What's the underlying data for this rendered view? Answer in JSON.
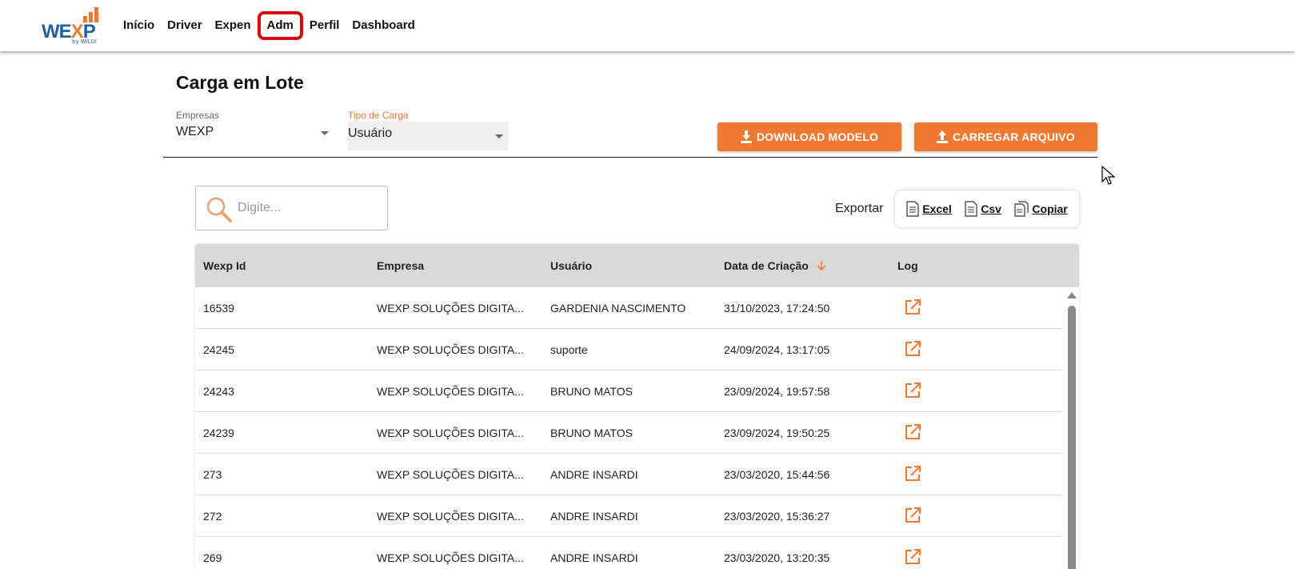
{
  "app": {
    "logo_text_a": "WE",
    "logo_text_x": "X",
    "logo_text_b": "P",
    "logo_by": "by WILLY",
    "accent_color": "#f07830",
    "highlight_color": "#e00000"
  },
  "nav": {
    "items": [
      {
        "label": "Início"
      },
      {
        "label": "Driver"
      },
      {
        "label": "Expen"
      },
      {
        "label": "Adm",
        "highlighted": true
      },
      {
        "label": "Perfil"
      },
      {
        "label": "Dashboard"
      }
    ]
  },
  "page": {
    "title": "Carga em Lote"
  },
  "filters": {
    "empresas_label": "Empresas",
    "empresas_value": "WEXP",
    "tipo_label": "Tipo de Carga",
    "tipo_value": "Usuário"
  },
  "actions": {
    "download_label": "DOWNLOAD MODELO",
    "upload_label": "CARREGAR ARQUIVO"
  },
  "search": {
    "placeholder": "Digite..."
  },
  "export": {
    "label": "Exportar",
    "excel": "Excel",
    "csv": "Csv",
    "copy": "Copiar"
  },
  "table": {
    "headers": [
      "Wexp Id",
      "Empresa",
      "Usuário",
      "Data de Criação",
      "Log"
    ],
    "sort_icon": "arrow-down-icon",
    "rows": [
      {
        "id": "16539",
        "empresa": "WEXP SOLUÇÕES DIGITA...",
        "usuario": "GARDENIA NASCIMENTO",
        "data": "31/10/2023, 17:24:50"
      },
      {
        "id": "24245",
        "empresa": "WEXP SOLUÇÕES DIGITA...",
        "usuario": "suporte",
        "data": "24/09/2024, 13:17:05"
      },
      {
        "id": "24243",
        "empresa": "WEXP SOLUÇÕES DIGITA...",
        "usuario": "BRUNO MATOS",
        "data": "23/09/2024, 19:57:58"
      },
      {
        "id": "24239",
        "empresa": "WEXP SOLUÇÕES DIGITA...",
        "usuario": "BRUNO MATOS",
        "data": "23/09/2024, 19:50:25"
      },
      {
        "id": "273",
        "empresa": "WEXP SOLUÇÕES DIGITA...",
        "usuario": "ANDRE INSARDI",
        "data": "23/03/2020, 15:44:56"
      },
      {
        "id": "272",
        "empresa": "WEXP SOLUÇÕES DIGITA...",
        "usuario": "ANDRE INSARDI",
        "data": "23/03/2020, 15:36:27"
      },
      {
        "id": "269",
        "empresa": "WEXP SOLUÇÕES DIGITA...",
        "usuario": "ANDRE INSARDI",
        "data": "23/03/2020, 13:20:35"
      }
    ]
  }
}
